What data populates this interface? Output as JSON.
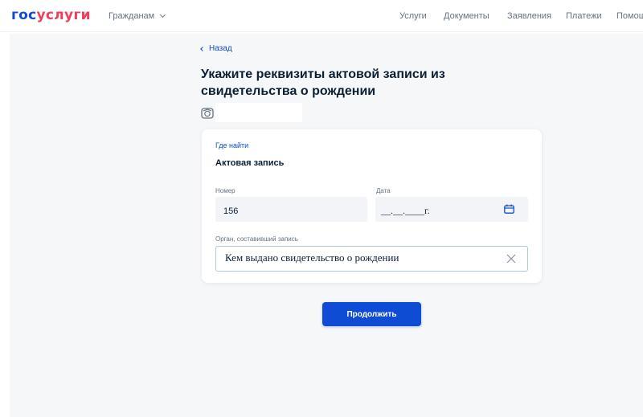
{
  "header": {
    "logo_part1": "гос",
    "logo_part2": "услуги",
    "citizens_menu": "Гражданам",
    "nav": [
      "Услуги",
      "Документы",
      "Заявления",
      "Платежи",
      "Помощь"
    ]
  },
  "back_link": "Назад",
  "title": "Укажите реквизиты актовой записи из свидетельства о рождении",
  "card": {
    "where_link": "Где найти",
    "section_title": "Актовая запись",
    "number_label": "Номер",
    "number_value": "156",
    "date_label": "Дата",
    "date_value": "__.__.____г.",
    "org_label": "Орган, составивший запись",
    "org_value": "Кем выдано свидетельство о рождении"
  },
  "continue_button": "Продолжить",
  "icons": [
    "chevron-down-icon",
    "back-arrow-icon",
    "document-icon",
    "calendar-icon",
    "close-icon"
  ],
  "colors": {
    "accent": "#0d4cd3",
    "logo_red": "#ee3f58",
    "text": "#0b1f33",
    "muted": "#66727f",
    "background": "#f6f7f9"
  }
}
